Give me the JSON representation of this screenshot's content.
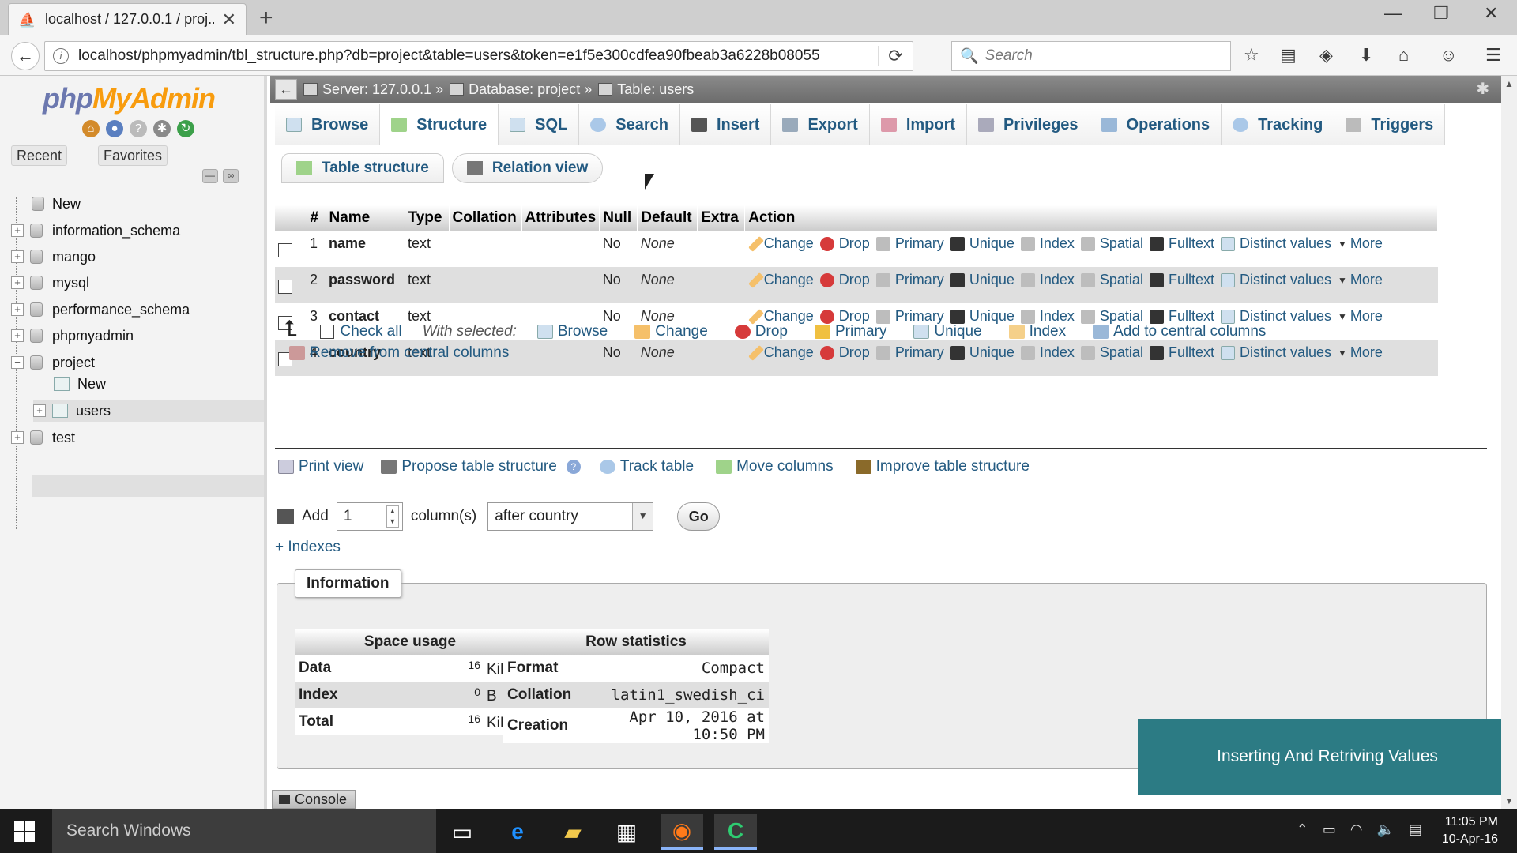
{
  "browser": {
    "tab_title": "localhost / 127.0.0.1 / proj...",
    "url": "localhost/phpmyadmin/tbl_structure.php?db=project&table=users&token=e1f5e300cdfea90fbeab3a6228b08055",
    "search_placeholder": "Search"
  },
  "sidebar": {
    "logo_php": "php",
    "logo_my": "MyAdmin",
    "recent": "Recent",
    "favorites": "Favorites",
    "tree": [
      {
        "label": "New"
      },
      {
        "label": "information_schema"
      },
      {
        "label": "mango"
      },
      {
        "label": "mysql"
      },
      {
        "label": "performance_schema"
      },
      {
        "label": "phpmyadmin"
      },
      {
        "label": "project"
      },
      {
        "label": "New"
      },
      {
        "label": "users"
      },
      {
        "label": "test"
      }
    ]
  },
  "breadcrumb": {
    "server": "Server: 127.0.0.1 »",
    "database": "Database: project »",
    "table": "Table: users"
  },
  "tabs": [
    {
      "label": "Browse"
    },
    {
      "label": "Structure"
    },
    {
      "label": "SQL"
    },
    {
      "label": "Search"
    },
    {
      "label": "Insert"
    },
    {
      "label": "Export"
    },
    {
      "label": "Import"
    },
    {
      "label": "Privileges"
    },
    {
      "label": "Operations"
    },
    {
      "label": "Tracking"
    },
    {
      "label": "Triggers"
    }
  ],
  "subtabs": {
    "table_structure": "Table structure",
    "relation_view": "Relation view"
  },
  "structure": {
    "headers": [
      "#",
      "Name",
      "Type",
      "Collation",
      "Attributes",
      "Null",
      "Default",
      "Extra",
      "Action"
    ],
    "actions": [
      "Change",
      "Drop",
      "Primary",
      "Unique",
      "Index",
      "Spatial",
      "Fulltext",
      "Distinct values",
      "More"
    ],
    "rows": [
      {
        "num": "1",
        "name": "name",
        "type": "text",
        "null": "No",
        "default": "None"
      },
      {
        "num": "2",
        "name": "password",
        "type": "text",
        "null": "No",
        "default": "None"
      },
      {
        "num": "3",
        "name": "contact",
        "type": "text",
        "null": "No",
        "default": "None"
      },
      {
        "num": "4",
        "name": "country",
        "type": "text",
        "null": "No",
        "default": "None"
      }
    ]
  },
  "bulk": {
    "check_all": "Check all",
    "with_selected": "With selected:",
    "browse": "Browse",
    "change": "Change",
    "drop": "Drop",
    "primary": "Primary",
    "unique": "Unique",
    "index": "Index",
    "add_central": "Add to central columns",
    "remove_central": "Remove from central columns"
  },
  "tools": {
    "print_view": "Print view",
    "propose": "Propose table structure",
    "track": "Track table",
    "move": "Move columns",
    "improve": "Improve table structure"
  },
  "add_columns": {
    "add": "Add",
    "count": "1",
    "columns_label": "column(s)",
    "position": "after country",
    "go": "Go"
  },
  "indexes_link": "+ Indexes",
  "information": {
    "legend": "Information",
    "space_usage": {
      "title": "Space usage",
      "rows": [
        {
          "k": "Data",
          "n": "16",
          "u": "KiB"
        },
        {
          "k": "Index",
          "n": "0",
          "u": "B"
        },
        {
          "k": "Total",
          "n": "16",
          "u": "KiB"
        }
      ]
    },
    "row_stats": {
      "title": "Row statistics",
      "rows": [
        {
          "k": "Format",
          "v": "Compact"
        },
        {
          "k": "Collation",
          "v": "latin1_swedish_ci"
        },
        {
          "k": "Creation",
          "v": "Apr 10, 2016 at 10:50 PM"
        }
      ]
    }
  },
  "console_label": "Console",
  "overlay_title": "Inserting And Retriving Values",
  "taskbar": {
    "search": "Search Windows",
    "time": "11:05 PM",
    "date": "10-Apr-16"
  },
  "colors": {
    "link": "#235a81",
    "overlay": "#2c7b84",
    "logo_php": "#6c78af",
    "logo_my": "#f89c0e"
  }
}
